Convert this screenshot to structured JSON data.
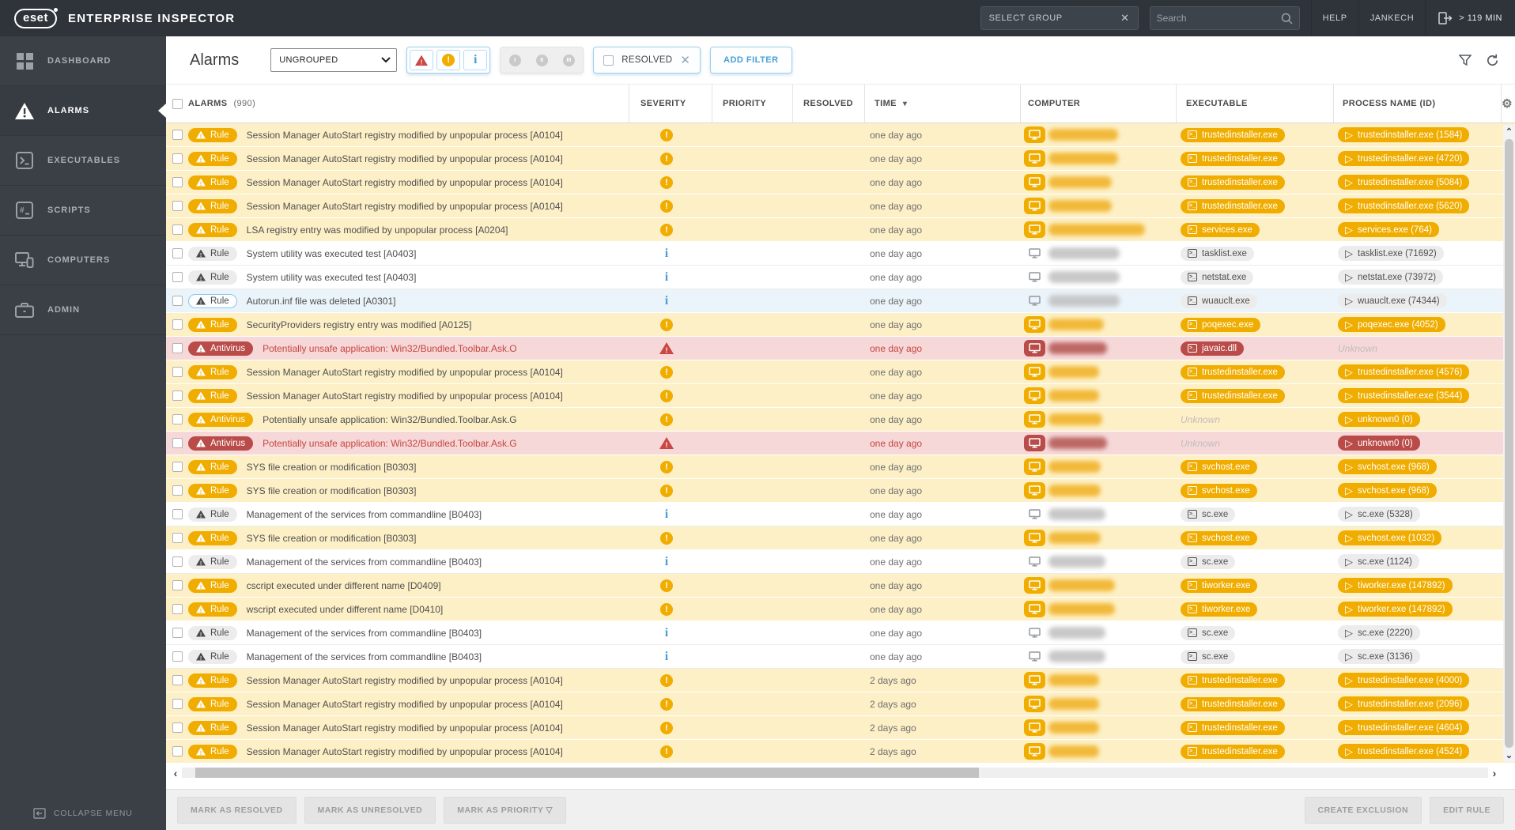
{
  "topbar": {
    "brand": "eset",
    "title": "ENTERPRISE INSPECTOR",
    "select_group_label": "SELECT GROUP",
    "search_placeholder": "Search",
    "help_label": "HELP",
    "user_label": "JANKECH",
    "session_timer": "> 119 MIN"
  },
  "sidebar": {
    "items": [
      {
        "label": "DASHBOARD"
      },
      {
        "label": "ALARMS",
        "active": true
      },
      {
        "label": "EXECUTABLES"
      },
      {
        "label": "SCRIPTS"
      },
      {
        "label": "COMPUTERS"
      },
      {
        "label": "ADMIN"
      }
    ],
    "collapse_label": "COLLAPSE MENU"
  },
  "filterbar": {
    "page_title": "Alarms",
    "group_select_value": "UNGROUPED",
    "severity_filters": [
      "critical",
      "warning",
      "info"
    ],
    "priority_filters": [
      "I",
      "II",
      "III"
    ],
    "resolved_label": "RESOLVED",
    "add_filter_label": "ADD FILTER"
  },
  "table": {
    "header": {
      "alarms": "ALARMS",
      "count": "(990)",
      "severity": "SEVERITY",
      "priority": "PRIORITY",
      "resolved": "RESOLVED",
      "time": "TIME",
      "computer": "COMPUTER",
      "executable": "EXECUTABLE",
      "process": "PROCESS NAME (ID)"
    }
  },
  "rows": [
    {
      "badge": "Rule",
      "badge_style": "yellow",
      "text": "Session Manager AutoStart registry modified by unpopular process [A0104]",
      "severity": "warning",
      "time": "one day ago",
      "row_style": "yellow",
      "computer_style": "yellow",
      "computer_width": 88,
      "executable": "trustedinstaller.exe",
      "executable_style": "yellow",
      "process": "trustedinstaller.exe (1584)",
      "process_style": "yellow"
    },
    {
      "badge": "Rule",
      "badge_style": "yellow",
      "text": "Session Manager AutoStart registry modified by unpopular process [A0104]",
      "severity": "warning",
      "time": "one day ago",
      "row_style": "yellow",
      "computer_style": "yellow",
      "computer_width": 88,
      "executable": "trustedinstaller.exe",
      "executable_style": "yellow",
      "process": "trustedinstaller.exe (4720)",
      "process_style": "yellow"
    },
    {
      "badge": "Rule",
      "badge_style": "yellow",
      "text": "Session Manager AutoStart registry modified by unpopular process [A0104]",
      "severity": "warning",
      "time": "one day ago",
      "row_style": "yellow",
      "computer_style": "yellow",
      "computer_width": 80,
      "executable": "trustedinstaller.exe",
      "executable_style": "yellow",
      "process": "trustedinstaller.exe (5084)",
      "process_style": "yellow"
    },
    {
      "badge": "Rule",
      "badge_style": "yellow",
      "text": "Session Manager AutoStart registry modified by unpopular process [A0104]",
      "severity": "warning",
      "time": "one day ago",
      "row_style": "yellow",
      "computer_style": "yellow",
      "computer_width": 80,
      "executable": "trustedinstaller.exe",
      "executable_style": "yellow",
      "process": "trustedinstaller.exe (5620)",
      "process_style": "yellow"
    },
    {
      "badge": "Rule",
      "badge_style": "yellow",
      "text": "LSA registry entry was modified by unpopular process [A0204]",
      "severity": "warning",
      "time": "one day ago",
      "row_style": "yellow",
      "computer_style": "yellow",
      "computer_width": 122,
      "executable": "services.exe",
      "executable_style": "yellow",
      "process": "services.exe (764)",
      "process_style": "yellow"
    },
    {
      "badge": "Rule",
      "badge_style": "gray",
      "text": "System utility was executed test [A0403]",
      "severity": "info",
      "time": "one day ago",
      "row_style": "white",
      "computer_style": "gray",
      "computer_width": 90,
      "executable": "tasklist.exe",
      "executable_style": "gray",
      "process": "tasklist.exe (71692)",
      "process_style": "gray"
    },
    {
      "badge": "Rule",
      "badge_style": "gray",
      "text": "System utility was executed test [A0403]",
      "severity": "info",
      "time": "one day ago",
      "row_style": "white",
      "computer_style": "gray",
      "computer_width": 90,
      "executable": "netstat.exe",
      "executable_style": "gray",
      "process": "netstat.exe (73972)",
      "process_style": "gray"
    },
    {
      "badge": "Rule",
      "badge_style": "outline",
      "text": "Autorun.inf file was deleted [A0301]",
      "severity": "info",
      "time": "one day ago",
      "row_style": "selected",
      "computer_style": "gray",
      "computer_width": 90,
      "executable": "wuauclt.exe",
      "executable_style": "gray",
      "process": "wuauclt.exe (74344)",
      "process_style": "gray"
    },
    {
      "badge": "Rule",
      "badge_style": "yellow",
      "text": "SecurityProviders registry entry was modified [A0125]",
      "severity": "warning",
      "time": "one day ago",
      "row_style": "yellow",
      "computer_style": "yellow",
      "computer_width": 70,
      "executable": "poqexec.exe",
      "executable_style": "yellow",
      "process": "poqexec.exe (4052)",
      "process_style": "yellow"
    },
    {
      "badge": "Antivirus",
      "badge_style": "red",
      "text": "Potentially unsafe application: Win32/Bundled.Toolbar.Ask.O",
      "severity": "critical",
      "time": "one day ago",
      "row_style": "red",
      "computer_style": "red",
      "computer_width": 74,
      "executable": "javaic.dll",
      "executable_style": "red",
      "process": "Unknown",
      "process_style": "unknown"
    },
    {
      "badge": "Rule",
      "badge_style": "yellow",
      "text": "Session Manager AutoStart registry modified by unpopular process [A0104]",
      "severity": "warning",
      "time": "one day ago",
      "row_style": "yellow",
      "computer_style": "yellow",
      "computer_width": 64,
      "executable": "trustedinstaller.exe",
      "executable_style": "yellow",
      "process": "trustedinstaller.exe (4576)",
      "process_style": "yellow"
    },
    {
      "badge": "Rule",
      "badge_style": "yellow",
      "text": "Session Manager AutoStart registry modified by unpopular process [A0104]",
      "severity": "warning",
      "time": "one day ago",
      "row_style": "yellow",
      "computer_style": "yellow",
      "computer_width": 64,
      "executable": "trustedinstaller.exe",
      "executable_style": "yellow",
      "process": "trustedinstaller.exe (3544)",
      "process_style": "yellow"
    },
    {
      "badge": "Antivirus",
      "badge_style": "yellow",
      "text": "Potentially unsafe application: Win32/Bundled.Toolbar.Ask.G",
      "severity": "warning",
      "time": "one day ago",
      "row_style": "yellow",
      "computer_style": "yellow",
      "computer_width": 68,
      "executable": "Unknown",
      "executable_style": "unknown",
      "process": "unknown0 (0)",
      "process_style": "yellow"
    },
    {
      "badge": "Antivirus",
      "badge_style": "red",
      "text": "Potentially unsafe application: Win32/Bundled.Toolbar.Ask.G",
      "severity": "critical",
      "time": "one day ago",
      "row_style": "red",
      "computer_style": "red",
      "computer_width": 74,
      "executable": "Unknown",
      "executable_style": "unknown",
      "process": "unknown0 (0)",
      "process_style": "red"
    },
    {
      "badge": "Rule",
      "badge_style": "yellow",
      "text": "SYS file creation or modification [B0303]",
      "severity": "warning",
      "time": "one day ago",
      "row_style": "yellow",
      "computer_style": "yellow",
      "computer_width": 66,
      "executable": "svchost.exe",
      "executable_style": "yellow",
      "process": "svchost.exe (968)",
      "process_style": "yellow"
    },
    {
      "badge": "Rule",
      "badge_style": "yellow",
      "text": "SYS file creation or modification [B0303]",
      "severity": "warning",
      "time": "one day ago",
      "row_style": "yellow",
      "computer_style": "yellow",
      "computer_width": 66,
      "executable": "svchost.exe",
      "executable_style": "yellow",
      "process": "svchost.exe (968)",
      "process_style": "yellow"
    },
    {
      "badge": "Rule",
      "badge_style": "gray",
      "text": "Management of the services from commandline [B0403]",
      "severity": "info",
      "time": "one day ago",
      "row_style": "white",
      "computer_style": "gray",
      "computer_width": 72,
      "executable": "sc.exe",
      "executable_style": "gray",
      "process": "sc.exe (5328)",
      "process_style": "gray"
    },
    {
      "badge": "Rule",
      "badge_style": "yellow",
      "text": "SYS file creation or modification [B0303]",
      "severity": "warning",
      "time": "one day ago",
      "row_style": "yellow",
      "computer_style": "yellow",
      "computer_width": 66,
      "executable": "svchost.exe",
      "executable_style": "yellow",
      "process": "svchost.exe (1032)",
      "process_style": "yellow"
    },
    {
      "badge": "Rule",
      "badge_style": "gray",
      "text": "Management of the services from commandline [B0403]",
      "severity": "info",
      "time": "one day ago",
      "row_style": "white",
      "computer_style": "gray",
      "computer_width": 72,
      "executable": "sc.exe",
      "executable_style": "gray",
      "process": "sc.exe (1124)",
      "process_style": "gray"
    },
    {
      "badge": "Rule",
      "badge_style": "yellow",
      "text": "cscript executed under different name [D0409]",
      "severity": "warning",
      "time": "one day ago",
      "row_style": "yellow",
      "computer_style": "yellow",
      "computer_width": 84,
      "executable": "tiworker.exe",
      "executable_style": "yellow",
      "process": "tiworker.exe (147892)",
      "process_style": "yellow"
    },
    {
      "badge": "Rule",
      "badge_style": "yellow",
      "text": "wscript executed under different name [D0410]",
      "severity": "warning",
      "time": "one day ago",
      "row_style": "yellow",
      "computer_style": "yellow",
      "computer_width": 84,
      "executable": "tiworker.exe",
      "executable_style": "yellow",
      "process": "tiworker.exe (147892)",
      "process_style": "yellow"
    },
    {
      "badge": "Rule",
      "badge_style": "gray",
      "text": "Management of the services from commandline [B0403]",
      "severity": "info",
      "time": "one day ago",
      "row_style": "white",
      "computer_style": "gray",
      "computer_width": 72,
      "executable": "sc.exe",
      "executable_style": "gray",
      "process": "sc.exe (2220)",
      "process_style": "gray"
    },
    {
      "badge": "Rule",
      "badge_style": "gray",
      "text": "Management of the services from commandline [B0403]",
      "severity": "info",
      "time": "one day ago",
      "row_style": "white",
      "computer_style": "gray",
      "computer_width": 72,
      "executable": "sc.exe",
      "executable_style": "gray",
      "process": "sc.exe (3136)",
      "process_style": "gray"
    },
    {
      "badge": "Rule",
      "badge_style": "yellow",
      "text": "Session Manager AutoStart registry modified by unpopular process [A0104]",
      "severity": "warning",
      "time": "2 days ago",
      "row_style": "yellow",
      "computer_style": "yellow",
      "computer_width": 64,
      "executable": "trustedinstaller.exe",
      "executable_style": "yellow",
      "process": "trustedinstaller.exe (4000)",
      "process_style": "yellow"
    },
    {
      "badge": "Rule",
      "badge_style": "yellow",
      "text": "Session Manager AutoStart registry modified by unpopular process [A0104]",
      "severity": "warning",
      "time": "2 days ago",
      "row_style": "yellow",
      "computer_style": "yellow",
      "computer_width": 64,
      "executable": "trustedinstaller.exe",
      "executable_style": "yellow",
      "process": "trustedinstaller.exe (2096)",
      "process_style": "yellow"
    },
    {
      "badge": "Rule",
      "badge_style": "yellow",
      "text": "Session Manager AutoStart registry modified by unpopular process [A0104]",
      "severity": "warning",
      "time": "2 days ago",
      "row_style": "yellow",
      "computer_style": "yellow",
      "computer_width": 64,
      "executable": "trustedinstaller.exe",
      "executable_style": "yellow",
      "process": "trustedinstaller.exe (4604)",
      "process_style": "yellow"
    },
    {
      "badge": "Rule",
      "badge_style": "yellow",
      "text": "Session Manager AutoStart registry modified by unpopular process [A0104]",
      "severity": "warning",
      "time": "2 days ago",
      "row_style": "yellow",
      "computer_style": "yellow",
      "computer_width": 64,
      "executable": "trustedinstaller.exe",
      "executable_style": "yellow",
      "process": "trustedinstaller.exe (4524)",
      "process_style": "yellow"
    }
  ],
  "bottombar": {
    "mark_resolved": "MARK AS RESOLVED",
    "mark_unresolved": "MARK AS UNRESOLVED",
    "mark_priority": "MARK AS PRIORITY",
    "create_exclusion": "CREATE EXCLUSION",
    "edit_rule": "EDIT RULE"
  },
  "colors": {
    "accent_yellow": "#f0ad00",
    "alert_red": "#b94b48",
    "row_yellow": "#fdf0c7",
    "row_red": "#f6d8d8",
    "row_selected": "#eaf4fa",
    "info_blue": "#4a9fd8",
    "topbar_bg": "#2f343a",
    "sidebar_bg": "#3a4046"
  }
}
